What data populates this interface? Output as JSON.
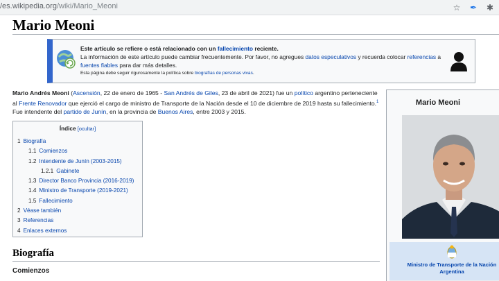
{
  "browser": {
    "url_host": "/es.wikipedia.org",
    "url_path": "/wiki/Mario_Meoni",
    "icons": [
      "star-icon",
      "feather-extension-icon",
      "puzzle-extension-icon"
    ]
  },
  "page": {
    "title": "Mario Meoni"
  },
  "notice": {
    "line1_a": "Este artículo se refiere o está relacionado con un ",
    "line1_link": "fallecimiento",
    "line1_b": " reciente.",
    "line2_a": "La información de este artículo puede cambiar frecuentemente. Por favor, no agregues ",
    "line2_link1": "datos especulativos",
    "line2_b": " y recuerda colocar ",
    "line2_link2": "referencias",
    "line2_c": " a",
    "line3_link": "fuentes fiables",
    "line3_b": " para dar más detalles.",
    "line4_a": "Esta página debe seguir rigurosamente la política sobre ",
    "line4_link": "biografías de personas vivas",
    "line4_b": "."
  },
  "intro": {
    "name": "Mario Andrés Meoni",
    "t1": " (",
    "l_ascension": "Ascensión",
    "t2": ", 22 de enero de 1965 - ",
    "l_sag": "San Andrés de Giles",
    "t3": ", 23 de abril de 2021) fue un ",
    "l_politico": "político",
    "t4": " argentino perteneciente al ",
    "l_frente": "Frente Renovador",
    "t5": " que ejerció el cargo de ministro de Transporte de la Nación desde el 10 de diciembre de 2019 hasta su fallecimiento.",
    "sup": "1",
    "t6": "  Fue intendente del ",
    "l_partido": "partido de Junín",
    "t7": ", en la provincia de ",
    "l_ba": "Buenos Aires",
    "t8": ", entre 2003 y 2015."
  },
  "toc": {
    "title": "Índice",
    "hide": "[ocultar]",
    "items": [
      {
        "num": "1",
        "label": "Biografía"
      },
      {
        "num": "1.1",
        "label": "Comienzos"
      },
      {
        "num": "1.2",
        "label": "Intendente de Junín (2003-2015)"
      },
      {
        "num": "1.2.1",
        "label": "Gabinete"
      },
      {
        "num": "1.3",
        "label": "Director Banco Provincia (2016-2019)"
      },
      {
        "num": "1.4",
        "label": "Ministro de Transporte (2019-2021)"
      },
      {
        "num": "1.5",
        "label": "Fallecimiento"
      },
      {
        "num": "2",
        "label": "Véase también"
      },
      {
        "num": "3",
        "label": "Referencias"
      },
      {
        "num": "4",
        "label": "Enlaces externos"
      }
    ]
  },
  "sections": {
    "h2": "Biografía",
    "h3": "Comienzos"
  },
  "infobox": {
    "name": "Mario Meoni",
    "role": "Ministro de Transporte de la Nación Argentina"
  },
  "colors": {
    "link": "#0645ad",
    "notice_accent": "#3366cc",
    "infobox_band": "#d6e4f5"
  }
}
